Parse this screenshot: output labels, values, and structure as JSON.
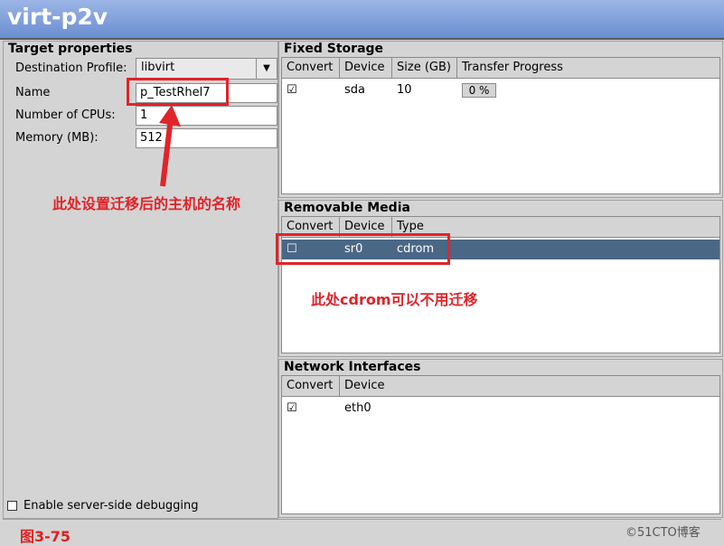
{
  "window": {
    "title": "virt-p2v"
  },
  "target": {
    "title": "Target properties",
    "destination_profile_label": "Destination Profile:",
    "destination_profile_value": "libvirt",
    "name_label": "Name",
    "name_value": "p_TestRhel7",
    "cpus_label": "Number of CPUs:",
    "cpus_value": "1",
    "memory_label": "Memory (MB):",
    "memory_value": "512",
    "debug_label": "Enable server-side debugging",
    "debug_checked": false
  },
  "fixed_storage": {
    "title": "Fixed Storage",
    "headers": [
      "Convert",
      "Device",
      "Size (GB)",
      "Transfer Progress"
    ],
    "rows": [
      {
        "convert": "☑",
        "device": "sda",
        "size": "10",
        "progress": "0 %"
      }
    ]
  },
  "removable_media": {
    "title": "Removable Media",
    "headers": [
      "Convert",
      "Device",
      "Type"
    ],
    "rows": [
      {
        "convert": "☐",
        "device": "sr0",
        "type": "cdrom"
      }
    ]
  },
  "network_interfaces": {
    "title": "Network Interfaces",
    "headers": [
      "Convert",
      "Device"
    ],
    "rows": [
      {
        "convert": "☑",
        "device": "eth0"
      }
    ]
  },
  "annotations": {
    "name_note": "此处设置迁移后的主机的名称",
    "cdrom_note": "此处cdrom可以不用迁移",
    "figure_label": "图3-75",
    "watermark": "©51CTO博客"
  },
  "colors": {
    "selected_row": "#4a6785",
    "annotation": "#e0242a",
    "titlebar": "#7c9ad8"
  }
}
